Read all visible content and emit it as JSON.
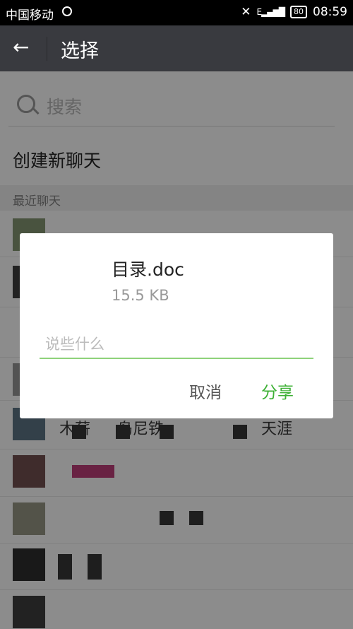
{
  "status_bar": {
    "carrier": "中国移动",
    "network": "E",
    "battery": "80",
    "time": "08:59"
  },
  "header": {
    "back_icon": "arrow-left-icon",
    "title": "选择"
  },
  "search": {
    "placeholder": "搜索"
  },
  "new_chat": {
    "label": "创建新聊天"
  },
  "recent": {
    "section_label": "最近聊天",
    "visible_fragments": {
      "row_4_start": "木薪",
      "row_4_mid": "岛尼铁",
      "row_4_end": "天涯"
    }
  },
  "dialog": {
    "file_name": "目录.doc",
    "file_size": "15.5 KB",
    "message_placeholder": "说些什么",
    "cancel_label": "取消",
    "share_label": "分享"
  },
  "colors": {
    "header_bg": "#393a3f",
    "accent": "#3cb034",
    "input_line": "#8ed27a"
  }
}
